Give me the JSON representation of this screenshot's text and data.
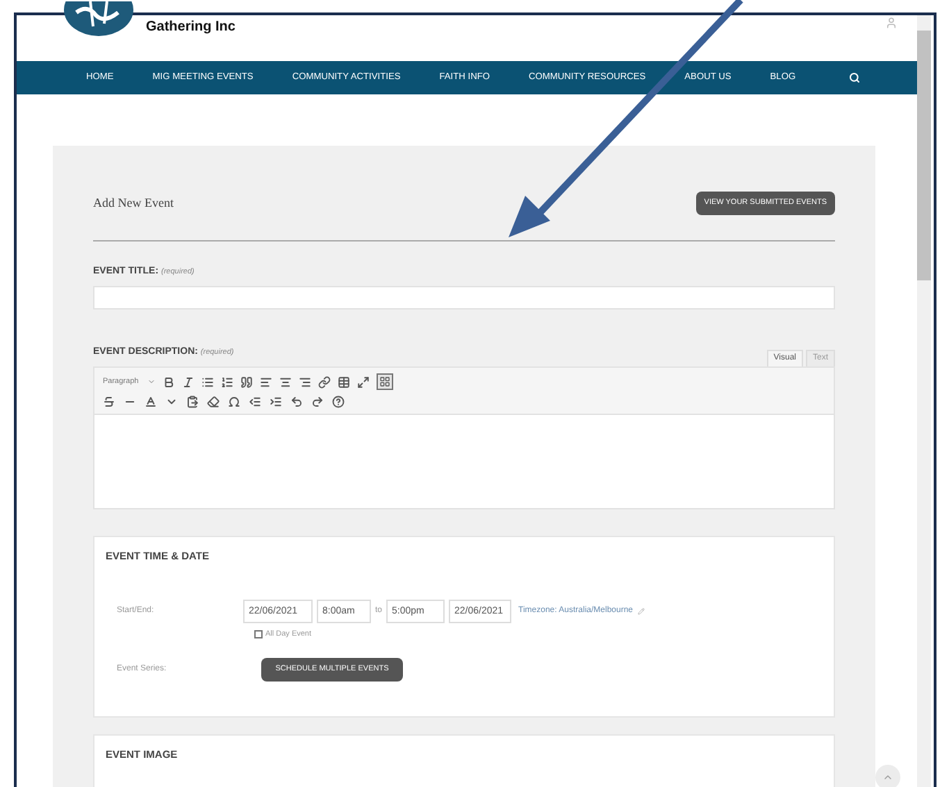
{
  "site": {
    "name": "Gathering Inc"
  },
  "nav": {
    "items": [
      {
        "label": "HOME"
      },
      {
        "label": "MIG MEETING EVENTS"
      },
      {
        "label": "COMMUNITY ACTIVITIES"
      },
      {
        "label": "FAITH INFO"
      },
      {
        "label": "COMMUNITY RESOURCES"
      },
      {
        "label": "ABOUT US"
      },
      {
        "label": "BLOG"
      }
    ]
  },
  "form": {
    "heading": "Add New Event",
    "submitted_button": "VIEW YOUR SUBMITTED EVENTS",
    "title_field": {
      "label": "EVENT TITLE:",
      "note": "(required)"
    },
    "description": {
      "label": "EVENT DESCRIPTION:",
      "note": "(required)",
      "tabs": [
        {
          "label": "Visual",
          "selected": true
        },
        {
          "label": "Text",
          "selected": false
        }
      ],
      "format_select": "Paragraph",
      "toolbar_toggle": {
        "selected": true
      }
    },
    "time_section": {
      "title": "EVENT TIME & DATE",
      "start_end_label": "Start/End:",
      "start_date": "22/06/2021",
      "start_time": "8:00am",
      "separator": "to",
      "end_time": "5:00pm",
      "end_date": "22/06/2021",
      "timezone_link": "Timezone: Australia/Melbourne",
      "all_day": {
        "label": "All Day Event",
        "checked": false
      },
      "series_label": "Event Series:",
      "series_button": "SCHEDULE MULTIPLE EVENTS"
    },
    "image_section": {
      "title": "EVENT IMAGE"
    }
  }
}
